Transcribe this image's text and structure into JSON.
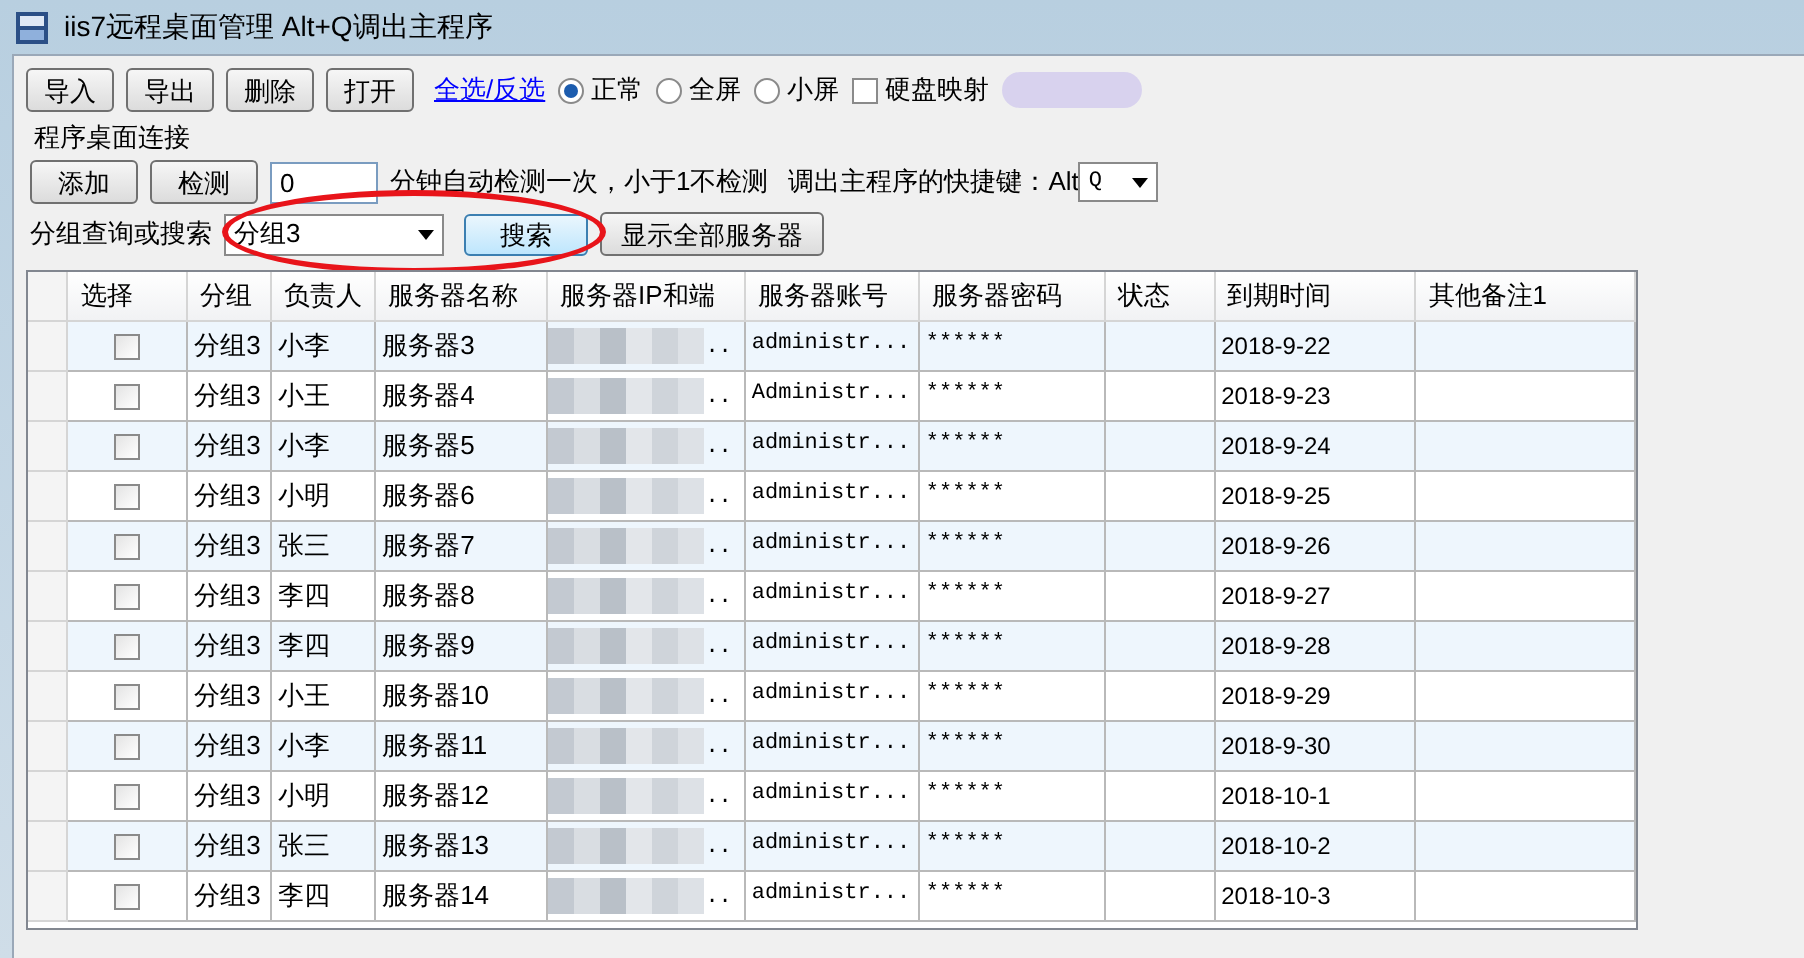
{
  "window": {
    "title": "iis7远程桌面管理 Alt+Q调出主程序"
  },
  "toolbar": {
    "buttons": [
      "导入",
      "导出",
      "删除",
      "打开"
    ],
    "select_link": "全选/反选",
    "view_modes": [
      {
        "label": "正常",
        "selected": true
      },
      {
        "label": "全屏",
        "selected": false
      },
      {
        "label": "小屏",
        "selected": false
      }
    ],
    "disk_mapping": {
      "label": "硬盘映射",
      "checked": false
    }
  },
  "group": {
    "title": "程序桌面连接",
    "buttons": [
      "添加",
      "检测"
    ],
    "interval": {
      "value": "0"
    },
    "interval_note": "分钟自动检测一次，小于1不检测",
    "hotkey_label": "调出主程序的快捷键：Alt",
    "hotkey": {
      "value": "Q"
    },
    "search_label": "分组查询或搜索",
    "search": {
      "value": "分组3"
    },
    "search_button": "搜索",
    "show_all_button": "显示全部服务器"
  },
  "table": {
    "columns": [
      "选择",
      "分组",
      "负责人",
      "服务器名称",
      "服务器IP和端",
      "服务器账号",
      "服务器密码",
      "状态",
      "到期时间",
      "其他备注1"
    ],
    "rows": [
      {
        "checked": false,
        "group": "分组3",
        "owner": "小李",
        "name": "服务器3",
        "ip": "..",
        "account": "administr...",
        "password": "******",
        "expires": "2018-9-22"
      },
      {
        "checked": false,
        "group": "分组3",
        "owner": "小王",
        "name": "服务器4",
        "ip": "..",
        "account": "Administr...",
        "password": "******",
        "expires": "2018-9-23"
      },
      {
        "checked": false,
        "group": "分组3",
        "owner": "小李",
        "name": "服务器5",
        "ip": "..",
        "account": "administr...",
        "password": "******",
        "expires": "2018-9-24"
      },
      {
        "checked": false,
        "group": "分组3",
        "owner": "小明",
        "name": "服务器6",
        "ip": "..",
        "account": "administr...",
        "password": "******",
        "expires": "2018-9-25"
      },
      {
        "checked": false,
        "group": "分组3",
        "owner": "张三",
        "name": "服务器7",
        "ip": "..",
        "account": "administr...",
        "password": "******",
        "expires": "2018-9-26"
      },
      {
        "checked": false,
        "group": "分组3",
        "owner": "李四",
        "name": "服务器8",
        "ip": "..",
        "account": "administr...",
        "password": "******",
        "expires": "2018-9-27"
      },
      {
        "checked": false,
        "group": "分组3",
        "owner": "李四",
        "name": "服务器9",
        "ip": "..",
        "account": "administr...",
        "password": "******",
        "expires": "2018-9-28"
      },
      {
        "checked": false,
        "group": "分组3",
        "owner": "小王",
        "name": "服务器10",
        "ip": "..",
        "account": "administr...",
        "password": "******",
        "expires": "2018-9-29"
      },
      {
        "checked": false,
        "group": "分组3",
        "owner": "小李",
        "name": "服务器11",
        "ip": "..",
        "account": "administr...",
        "password": "******",
        "expires": "2018-9-30"
      },
      {
        "checked": false,
        "group": "分组3",
        "owner": "小明",
        "name": "服务器12",
        "ip": "..",
        "account": "administr...",
        "password": "******",
        "expires": "2018-10-1"
      },
      {
        "checked": false,
        "group": "分组3",
        "owner": "张三",
        "name": "服务器13",
        "ip": "..",
        "account": "administr...",
        "password": "******",
        "expires": "2018-10-2"
      },
      {
        "checked": false,
        "group": "分组3",
        "owner": "李四",
        "name": "服务器14",
        "ip": "..",
        "account": "administr...",
        "password": "******",
        "expires": "2018-10-3"
      }
    ]
  }
}
